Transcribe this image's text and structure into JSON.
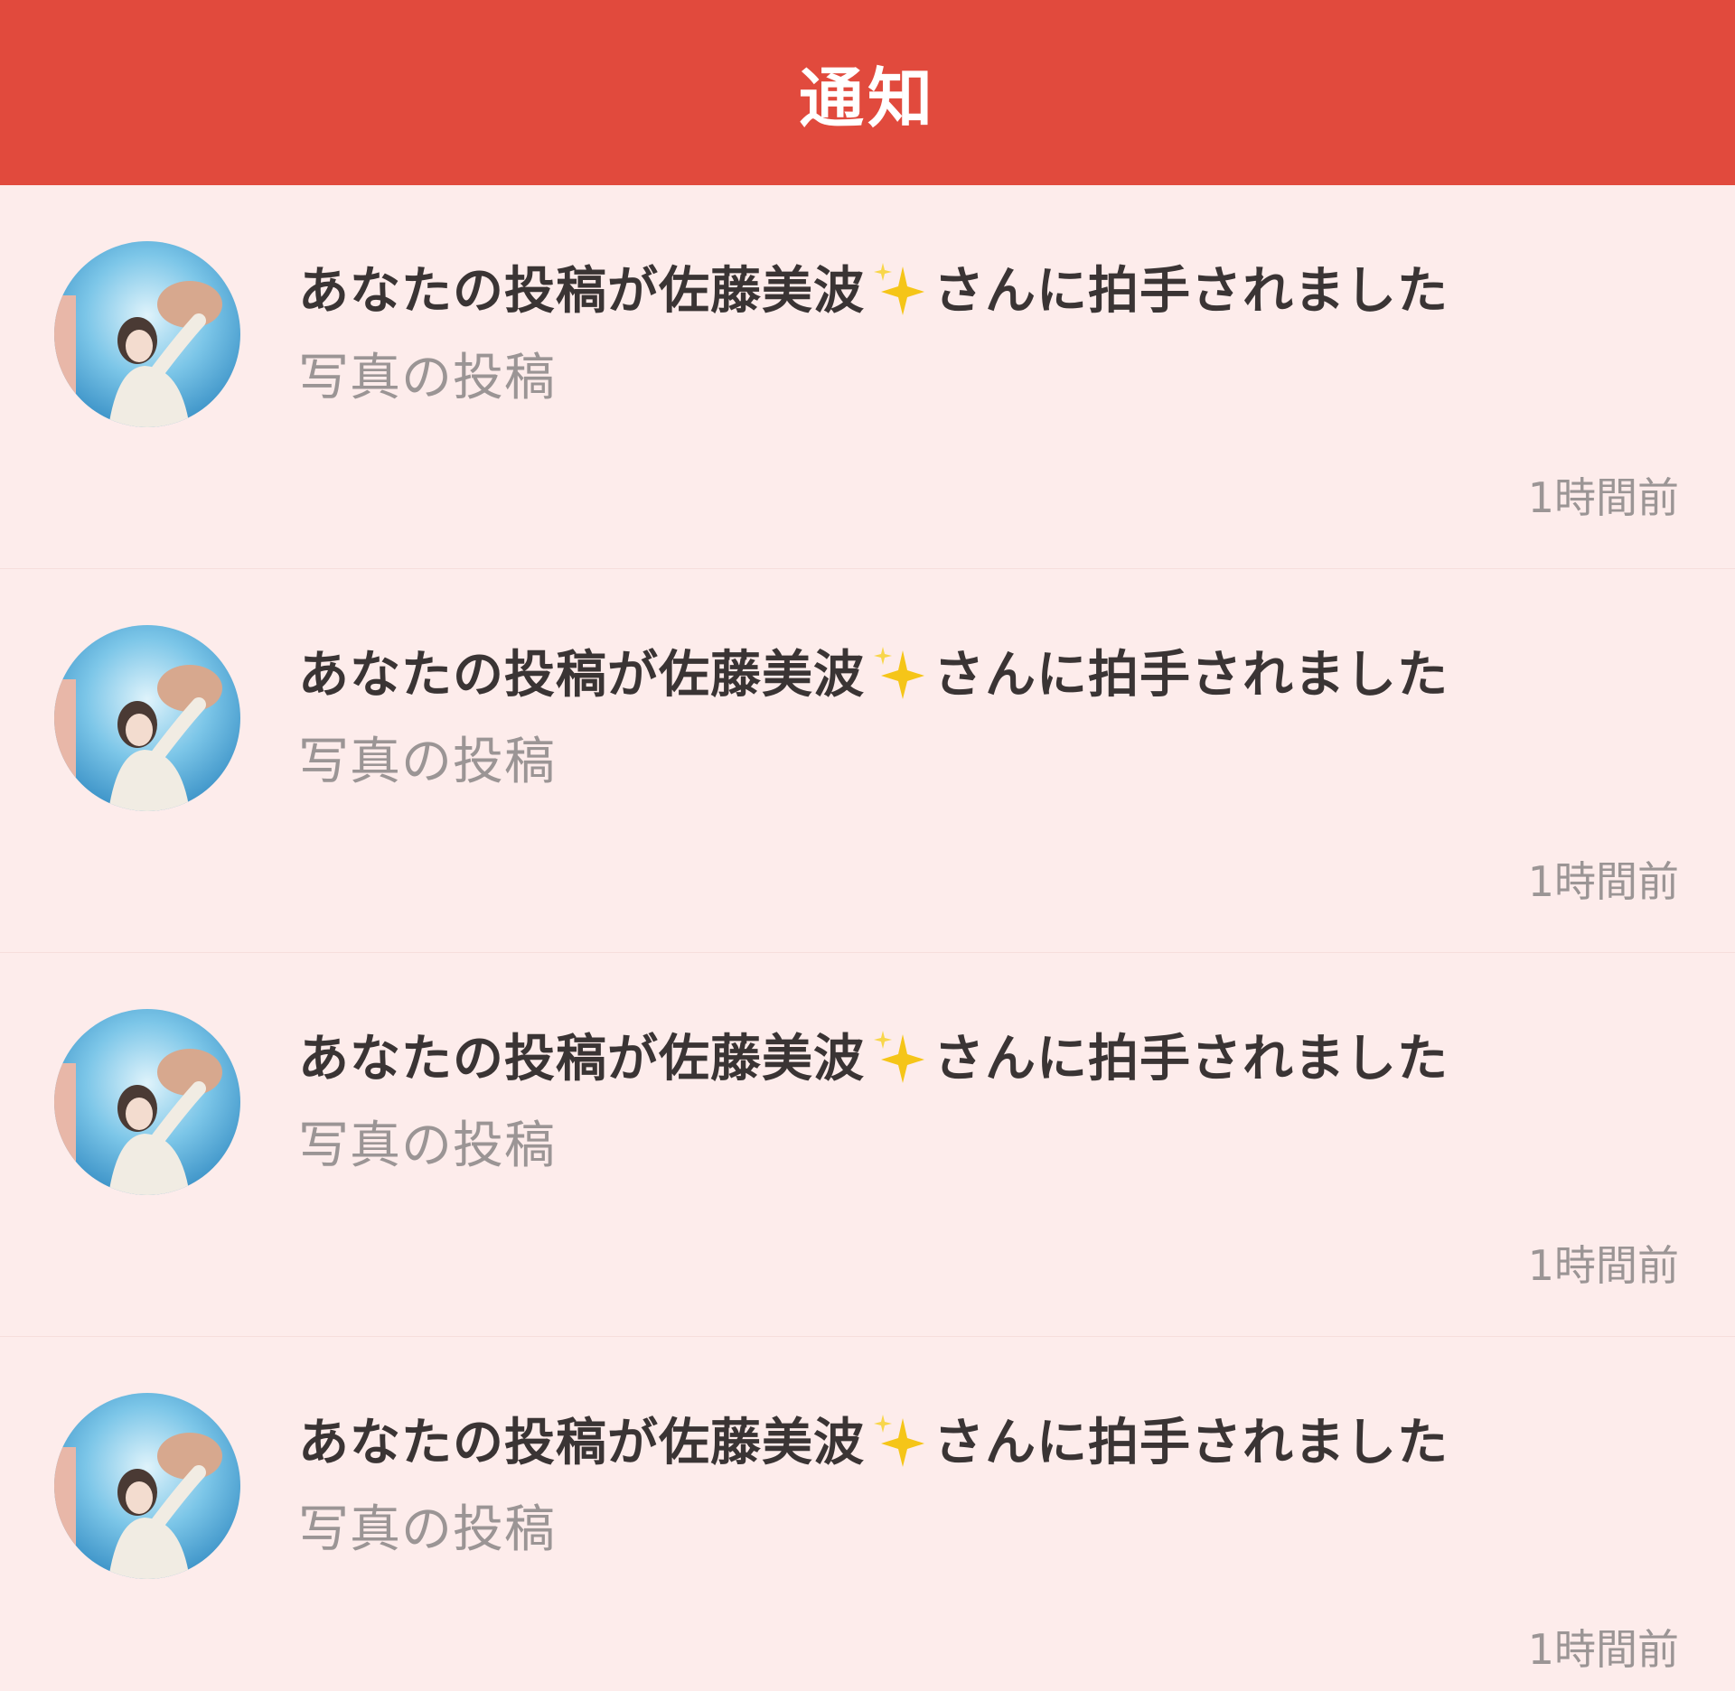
{
  "header": {
    "title": "通知"
  },
  "notifications": [
    {
      "title_before": "あなたの投稿が佐藤美波",
      "title_after": "さんに拍手されました",
      "icon": "sparkles-icon",
      "subtitle": "写真の投稿",
      "time": "1時間前"
    },
    {
      "title_before": "あなたの投稿が佐藤美波",
      "title_after": "さんに拍手されました",
      "icon": "sparkles-icon",
      "subtitle": "写真の投稿",
      "time": "1時間前"
    },
    {
      "title_before": "あなたの投稿が佐藤美波",
      "title_after": "さんに拍手されました",
      "icon": "sparkles-icon",
      "subtitle": "写真の投稿",
      "time": "1時間前"
    },
    {
      "title_before": "あなたの投稿が佐藤美波",
      "title_after": "さんに拍手されました",
      "icon": "sparkles-icon",
      "subtitle": "写真の投稿",
      "time": "1時間前"
    }
  ],
  "colors": {
    "header": "#e14a3d",
    "background": "#fdeceb",
    "title_text": "#3a3434",
    "muted_text": "#9b9595",
    "sparkle": "#f5c518"
  }
}
